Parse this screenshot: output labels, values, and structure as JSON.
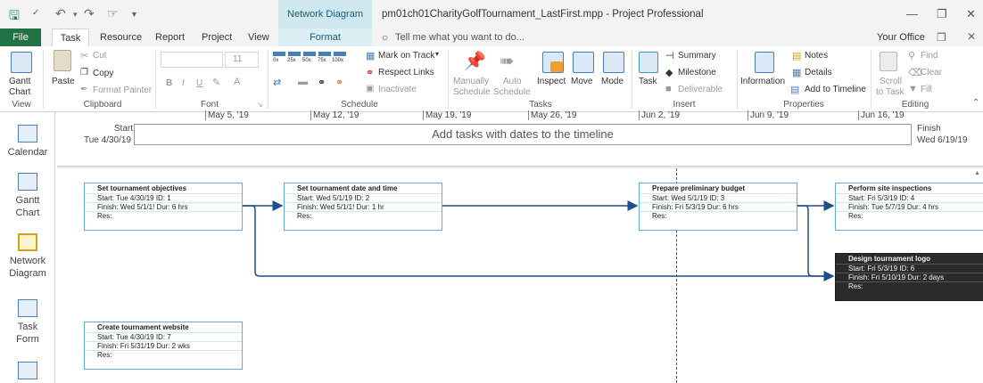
{
  "app": {
    "context_title": "Network Diagram Tools",
    "document_title": "pm01ch01CharityGolfTournament_LastFirst.mpp - Project Professional"
  },
  "tabs": {
    "file": "File",
    "task": "Task",
    "resource": "Resource",
    "report": "Report",
    "project": "Project",
    "view": "View",
    "format": "Format",
    "tell_me": "Tell me what you want to do...",
    "user": "Your Office"
  },
  "ribbon": {
    "view_group": {
      "gantt": "Gantt",
      "chart": "Chart",
      "label": "View"
    },
    "clipboard": {
      "paste": "Paste",
      "cut": "Cut",
      "copy": "Copy",
      "format_painter": "Format Painter",
      "label": "Clipboard"
    },
    "font": {
      "size": "11",
      "bold": "B",
      "italic": "I",
      "underline": "U",
      "label": "Font"
    },
    "schedule": {
      "pcts": [
        "0x",
        "25x",
        "50x",
        "75x",
        "100x"
      ],
      "mark_on_track": "Mark on Track",
      "respect_links": "Respect Links",
      "inactivate": "Inactivate",
      "label": "Schedule"
    },
    "tasks": {
      "manually": "Manually",
      "auto": "Auto",
      "schedule": "Schedule",
      "inspect": "Inspect",
      "move": "Move",
      "mode": "Mode",
      "label": "Tasks"
    },
    "insert": {
      "task": "Task",
      "summary": "Summary",
      "milestone": "Milestone",
      "deliverable": "Deliverable",
      "label": "Insert"
    },
    "properties": {
      "information": "Information",
      "notes": "Notes",
      "details": "Details",
      "add_to_timeline": "Add to Timeline",
      "label": "Properties"
    },
    "editing": {
      "scroll": "Scroll",
      "to_task": "to Task",
      "find": "Find",
      "clear": "Clear",
      "fill": "Fill",
      "label": "Editing"
    }
  },
  "timescale": [
    "May 5, '19",
    "May 12, '19",
    "May 19, '19",
    "May 26, '19",
    "Jun 2, '19",
    "Jun 9, '19",
    "Jun 16, '19"
  ],
  "timeline": {
    "start_label": "Start",
    "start_date": "Tue 4/30/19",
    "finish_label": "Finish",
    "finish_date": "Wed 6/19/19",
    "placeholder": "Add tasks with dates to the timeline"
  },
  "views": [
    {
      "label1": "Calendar",
      "label2": ""
    },
    {
      "label1": "Gantt",
      "label2": "Chart"
    },
    {
      "label1": "Network",
      "label2": "Diagram"
    },
    {
      "label1": "Task",
      "label2": "Form"
    }
  ],
  "nodes": [
    {
      "title": "Set tournament objectives",
      "start": "Start: Tue 4/30/19 ID: 1",
      "finish": "Finish: Wed 5/1/1! Dur: 6 hrs",
      "res": "Res:"
    },
    {
      "title": "Set tournament date and time",
      "start": "Start: Wed 5/1/19 ID: 2",
      "finish": "Finish: Wed 5/1/1! Dur: 1 hr",
      "res": "Res:"
    },
    {
      "title": "Prepare preliminary budget",
      "start": "Start: Wed 5/1/19 ID: 3",
      "finish": "Finish: Fri 5/3/19 Dur: 6 hrs",
      "res": "Res:"
    },
    {
      "title": "Perform site inspections",
      "start": "Start: Fri 5/3/19 ID: 4",
      "finish": "Finish: Tue 5/7/19 Dur: 4 hrs",
      "res": "Res:"
    },
    {
      "title": "Design tournament logo",
      "start": "Start: Fri 5/3/19 ID: 6",
      "finish": "Finish: Fri 5/10/19 Dur: 2 days",
      "res": "Res:"
    },
    {
      "title": "Create tournament website",
      "start": "Start: Tue 4/30/19 ID: 7",
      "finish": "Finish: Fri 5/31/19 Dur: 2 wks",
      "res": "Res:"
    }
  ]
}
